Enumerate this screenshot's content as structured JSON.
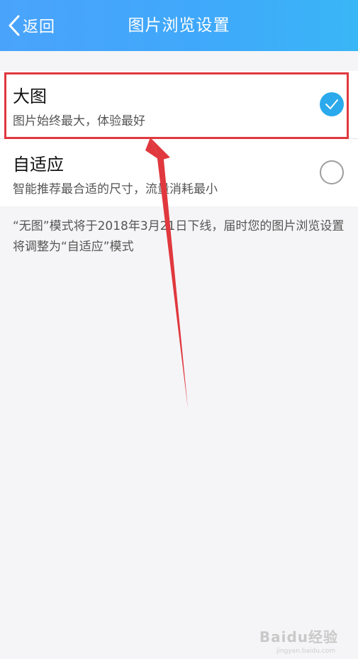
{
  "header": {
    "back_label": "返回",
    "title": "图片浏览设置",
    "back_icon": "chevron-left-icon"
  },
  "options": [
    {
      "title": "大图",
      "description": "图片始终最大，体验最好",
      "selected": true
    },
    {
      "title": "自适应",
      "description": "智能推荐最合适的尺寸，流量消耗最小",
      "selected": false
    }
  ],
  "notice": "“无图”模式将于2018年3月21日下线，届时您的图片浏览设置将调整为“自适应”模式",
  "watermark": {
    "logo_text": "Baidu经验",
    "url": "jingyan.baidu.com"
  },
  "colors": {
    "header_start": "#4aa3fb",
    "header_end": "#39b6f6",
    "accent": "#2aa9ec",
    "annotation_red": "#e0383e",
    "background": "#f5f5f7"
  }
}
